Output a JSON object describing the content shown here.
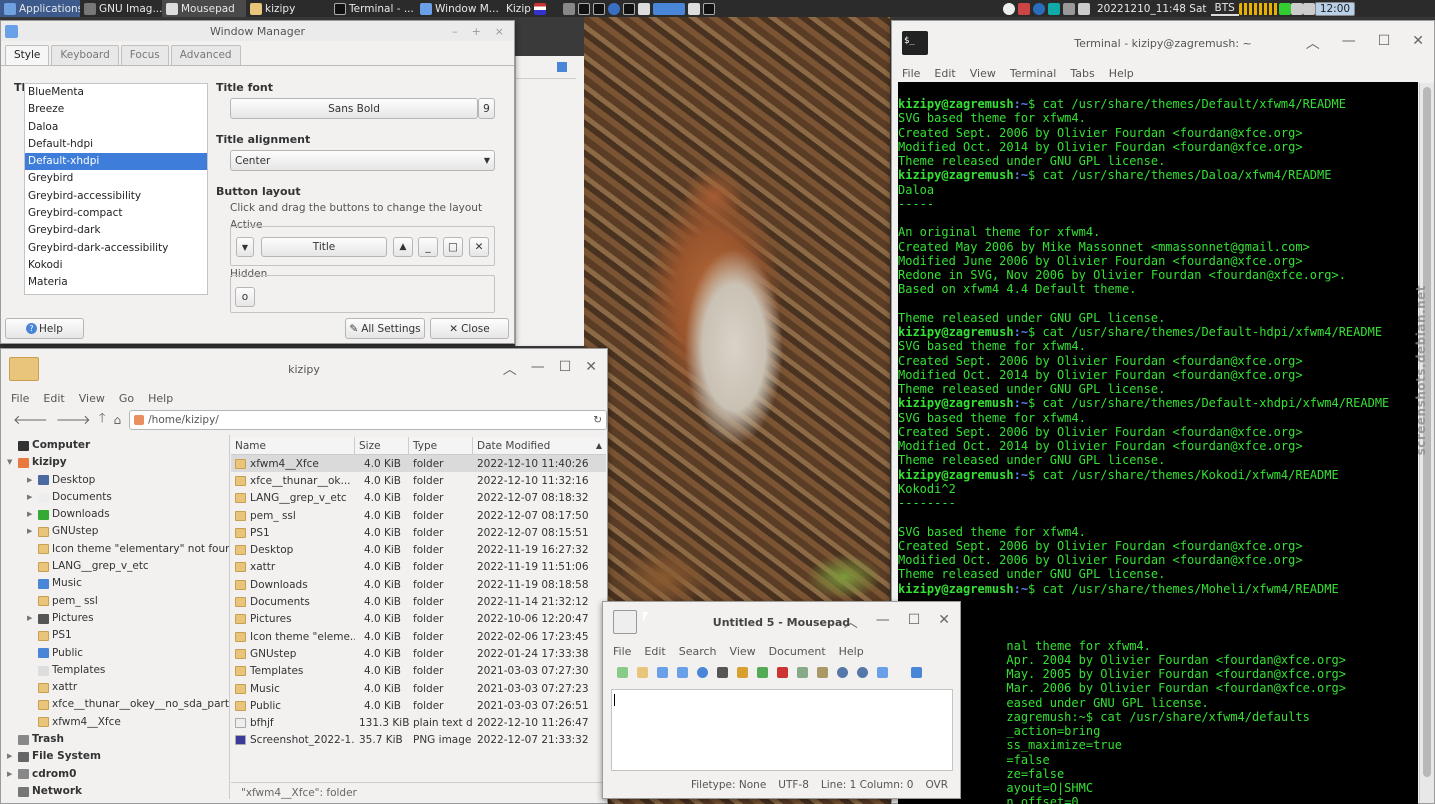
{
  "panel": {
    "applications": "Applications",
    "tasks": [
      "GNU Imag...",
      "Mousepad",
      "kizipy",
      "Terminal - ...",
      "Window M...",
      "Kizip"
    ],
    "clock": "20221210_11:48 Sat",
    "keyboard": "BTS",
    "time_box": "12:00"
  },
  "wm": {
    "title": "Window Manager",
    "tabs": [
      "Style",
      "Keyboard",
      "Focus",
      "Advanced"
    ],
    "theme_label": "Theme",
    "themes": [
      "BlueMenta",
      "Breeze",
      "Daloa",
      "Default-hdpi",
      "Default-xhdpi",
      "Greybird",
      "Greybird-accessibility",
      "Greybird-compact",
      "Greybird-dark",
      "Greybird-dark-accessibility",
      "Kokodi",
      "Materia"
    ],
    "selected_theme": "Default-xhdpi",
    "title_font_label": "Title font",
    "title_font": "Sans Bold",
    "title_font_size": "9",
    "title_alignment_label": "Title alignment",
    "title_alignment": "Center",
    "button_layout_label": "Button layout",
    "button_layout_hint": "Click and drag the buttons to change the layout",
    "active_label": "Active",
    "active_title": "Title",
    "hidden_label": "Hidden",
    "help": "Help",
    "all_settings": "All Settings",
    "close": "Close"
  },
  "fm": {
    "title": "kizipy",
    "menu": [
      "File",
      "Edit",
      "View",
      "Go",
      "Help"
    ],
    "location": "/home/kizipy/",
    "tree": [
      {
        "label": "Computer",
        "level": 0,
        "bold": true
      },
      {
        "label": "kizipy",
        "level": 0,
        "bold": true
      },
      {
        "label": "Desktop",
        "level": 1
      },
      {
        "label": "Documents",
        "level": 1
      },
      {
        "label": "Downloads",
        "level": 1
      },
      {
        "label": "GNUstep",
        "level": 1
      },
      {
        "label": "Icon theme \"elementary\" not found",
        "level": 1
      },
      {
        "label": "LANG__grep_v_etc",
        "level": 1
      },
      {
        "label": "Music",
        "level": 1
      },
      {
        "label": "pem_ ssl",
        "level": 1
      },
      {
        "label": "Pictures",
        "level": 1
      },
      {
        "label": "PS1",
        "level": 1
      },
      {
        "label": "Public",
        "level": 1
      },
      {
        "label": "Templates",
        "level": 1
      },
      {
        "label": "xattr",
        "level": 1
      },
      {
        "label": "xfce__thunar__okey__no_sda_partitions",
        "level": 1
      },
      {
        "label": "xfwm4__Xfce",
        "level": 1
      },
      {
        "label": "Trash",
        "level": 0,
        "bold": true
      },
      {
        "label": "File System",
        "level": 0,
        "bold": true
      },
      {
        "label": "cdrom0",
        "level": 0,
        "bold": true
      },
      {
        "label": "Network",
        "level": 0,
        "bold": true
      }
    ],
    "columns": [
      "Name",
      "Size",
      "Type",
      "Date Modified"
    ],
    "files": [
      [
        "xfwm4__Xfce",
        "4.0  KiB",
        "folder",
        "2022-12-10 11:40:26"
      ],
      [
        "xfce__thunar__ok...",
        "4.0  KiB",
        "folder",
        "2022-12-10 11:32:16"
      ],
      [
        "LANG__grep_v_etc",
        "4.0  KiB",
        "folder",
        "2022-12-07 08:18:32"
      ],
      [
        "pem_ ssl",
        "4.0  KiB",
        "folder",
        "2022-12-07 08:17:50"
      ],
      [
        "PS1",
        "4.0  KiB",
        "folder",
        "2022-12-07 08:15:51"
      ],
      [
        "Desktop",
        "4.0  KiB",
        "folder",
        "2022-11-19 16:27:32"
      ],
      [
        "xattr",
        "4.0  KiB",
        "folder",
        "2022-11-19 11:51:06"
      ],
      [
        "Downloads",
        "4.0  KiB",
        "folder",
        "2022-11-19 08:18:58"
      ],
      [
        "Documents",
        "4.0  KiB",
        "folder",
        "2022-11-14 21:32:12"
      ],
      [
        "Pictures",
        "4.0  KiB",
        "folder",
        "2022-10-06 12:20:47"
      ],
      [
        "Icon theme \"eleme...",
        "4.0  KiB",
        "folder",
        "2022-02-06 17:23:45"
      ],
      [
        "GNUstep",
        "4.0  KiB",
        "folder",
        "2022-01-24 17:33:38"
      ],
      [
        "Templates",
        "4.0  KiB",
        "folder",
        "2021-03-03 07:27:30"
      ],
      [
        "Music",
        "4.0  KiB",
        "folder",
        "2021-03-03 07:27:23"
      ],
      [
        "Public",
        "4.0  KiB",
        "folder",
        "2021-03-03 07:26:51"
      ],
      [
        "bfhjf",
        "131.3  KiB",
        "plain text do",
        "2022-12-10 11:26:47"
      ],
      [
        "Screenshot_2022-1...",
        "35.7  KiB",
        "PNG image",
        "2022-12-07 21:33:32"
      ]
    ],
    "status": "\"xfwm4__Xfce\": folder"
  },
  "terminal": {
    "title": "Terminal - kizipy@zagremush: ~",
    "menu": [
      "File",
      "Edit",
      "View",
      "Terminal",
      "Tabs",
      "Help"
    ],
    "prompt": "kizipy@zagremush",
    "lines": [
      {
        "p": true,
        "t": "cat /usr/share/themes/Default/xfwm4/README"
      },
      {
        "t": "SVG based theme for xfwm4."
      },
      {
        "t": "Created Sept. 2006 by Olivier Fourdan <fourdan@xfce.org>"
      },
      {
        "t": "Modified Oct. 2014 by Olivier Fourdan <fourdan@xfce.org>"
      },
      {
        "t": "Theme released under GNU GPL license."
      },
      {
        "p": true,
        "t": "cat /usr/share/themes/Daloa/xfwm4/README"
      },
      {
        "t": "Daloa"
      },
      {
        "t": "-----"
      },
      {
        "t": ""
      },
      {
        "t": "An original theme for xfwm4."
      },
      {
        "t": "Created May 2006 by Mike Massonnet <mmassonnet@gmail.com>"
      },
      {
        "t": "Modified June 2006 by Olivier Fourdan <fourdan@xfce.org>"
      },
      {
        "t": "Redone in SVG, Nov 2006 by Olivier Fourdan <fourdan@xfce.org>."
      },
      {
        "t": "Based on xfwm4 4.4 Default theme."
      },
      {
        "t": ""
      },
      {
        "t": "Theme released under GNU GPL license."
      },
      {
        "p": true,
        "t": "cat /usr/share/themes/Default-hdpi/xfwm4/README"
      },
      {
        "t": "SVG based theme for xfwm4."
      },
      {
        "t": "Created Sept. 2006 by Olivier Fourdan <fourdan@xfce.org>"
      },
      {
        "t": "Modified Oct. 2014 by Olivier Fourdan <fourdan@xfce.org>"
      },
      {
        "t": "Theme released under GNU GPL license."
      },
      {
        "p": true,
        "t": "cat /usr/share/themes/Default-xhdpi/xfwm4/README"
      },
      {
        "t": "SVG based theme for xfwm4."
      },
      {
        "t": "Created Sept. 2006 by Olivier Fourdan <fourdan@xfce.org>"
      },
      {
        "t": "Modified Oct. 2014 by Olivier Fourdan <fourdan@xfce.org>"
      },
      {
        "t": "Theme released under GNU GPL license."
      },
      {
        "p": true,
        "t": "cat /usr/share/themes/Kokodi/xfwm4/README"
      },
      {
        "t": "Kokodi^2"
      },
      {
        "t": "--------"
      },
      {
        "t": ""
      },
      {
        "t": "SVG based theme for xfwm4."
      },
      {
        "t": "Created Sept. 2006 by Olivier Fourdan <fourdan@xfce.org>"
      },
      {
        "t": "Modified Oct. 2006 by Olivier Fourdan <fourdan@xfce.org>"
      },
      {
        "t": "Theme released under GNU GPL license."
      },
      {
        "p": true,
        "t": "cat /usr/share/themes/Moheli/xfwm4/README"
      },
      {
        "t": ""
      },
      {
        "t": ""
      },
      {
        "t": ""
      },
      {
        "t": "               nal theme for xfwm4."
      },
      {
        "t": "               Apr. 2004 by Olivier Fourdan <fourdan@xfce.org>"
      },
      {
        "t": "               May. 2005 by Olivier Fourdan <fourdan@xfce.org>"
      },
      {
        "t": "               Mar. 2006 by Olivier Fourdan <fourdan@xfce.org>"
      },
      {
        "t": "               eased under GNU GPL license."
      },
      {
        "t": "               zagremush:~$ cat /usr/share/xfwm4/defaults"
      },
      {
        "t": "               _action=bring"
      },
      {
        "t": "               ss_maximize=true"
      },
      {
        "t": "               =false"
      },
      {
        "t": "               ze=false"
      },
      {
        "t": "               ayout=O|SHMC"
      },
      {
        "t": "               n_offset=0"
      }
    ],
    "watermark": "screenshots.debian.net"
  },
  "mousepad": {
    "title": "Untitled 5 - Mousepad",
    "menu": [
      "File",
      "Edit",
      "Search",
      "View",
      "Document",
      "Help"
    ],
    "filetype": "Filetype: None",
    "encoding": "UTF-8",
    "position": "Line: 1 Column: 0",
    "mode": "OVR"
  }
}
